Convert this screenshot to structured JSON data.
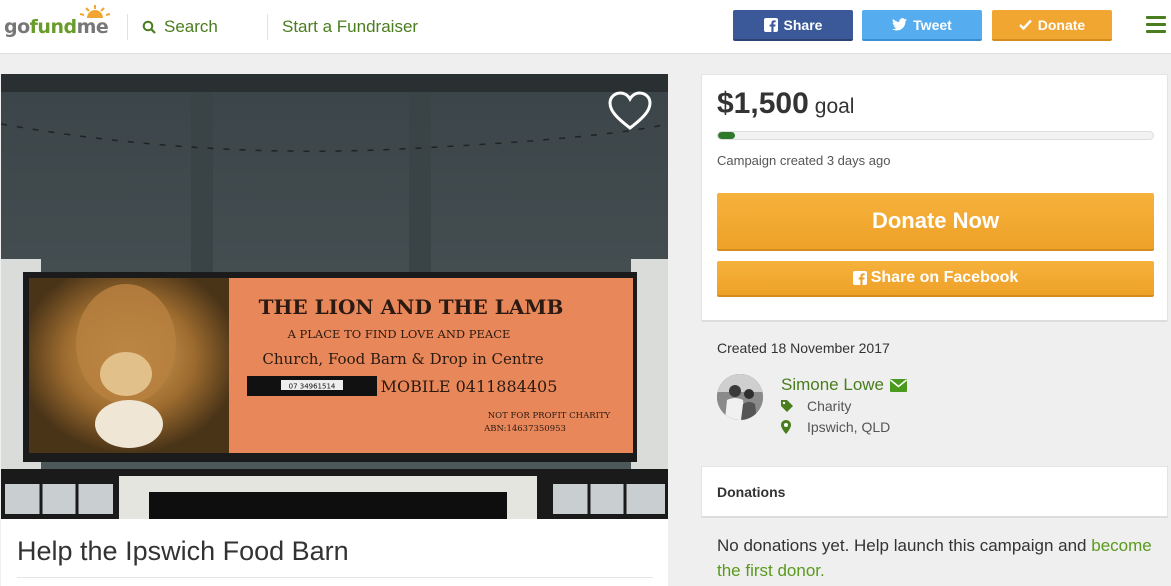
{
  "header": {
    "logo": {
      "go": "go",
      "fund": "fund",
      "me": "me"
    },
    "search_label": "Search",
    "start_label": "Start a Fundraiser",
    "share_label": "Share",
    "tweet_label": "Tweet",
    "donate_label": "Donate"
  },
  "campaign": {
    "title": "Help the Ipswich Food Barn",
    "photo_sign": {
      "heading": "THE LION AND THE LAMB",
      "line1": "A PLACE TO FIND LOVE AND PEACE",
      "line2": "Church, Food Barn & Drop in Centre",
      "phone": "07 34961514",
      "mobile": "MOBILE 0411884405",
      "charity": "NOT FOR PROFIT CHARITY",
      "abn": "ABN:14637350953"
    }
  },
  "goal_card": {
    "amount": "$1,500",
    "goal_label": "goal",
    "progress_fraction": 0.04,
    "created_ago": "Campaign created 3 days ago",
    "donate_now": "Donate Now",
    "share_facebook": "Share on Facebook"
  },
  "organizer": {
    "created_date": "Created 18 November 2017",
    "name": "Simone Lowe",
    "category": "Charity",
    "location": "Ipswich, QLD"
  },
  "donations": {
    "title": "Donations",
    "empty_text": "No donations yet. Help launch this campaign and ",
    "empty_link": "become the first donor."
  },
  "colors": {
    "brand_green": "#4a7d1e",
    "facebook": "#3b5998",
    "twitter": "#55acee",
    "donate_orange": "#f0a630"
  }
}
